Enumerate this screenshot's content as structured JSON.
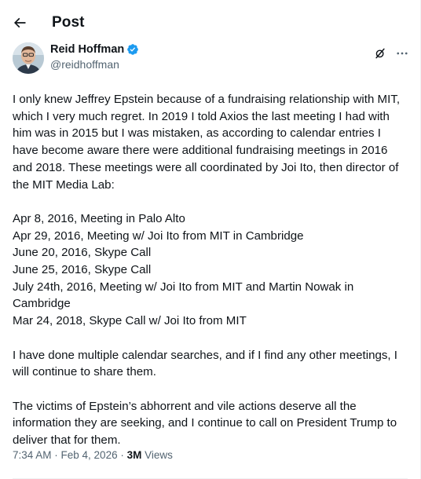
{
  "header": {
    "back_icon": "arrow-left-icon",
    "title": "Post"
  },
  "author": {
    "display_name": "Reid Hoffman",
    "handle": "@reidhoffman",
    "verified_color": "#1d9bf0",
    "verified_icon": "verified-badge-icon",
    "grok_icon": "grok-icon",
    "more_icon": "more-horizontal-icon"
  },
  "post": {
    "paragraphs": [
      "I only knew Jeffrey Epstein because of a fundraising relationship with MIT, which I very much regret. In 2019 I told Axios the last meeting I had with him was in 2015 but I was mistaken, as according to calendar entries I have become aware there were additional fundraising meetings in 2016 and 2018. These meetings were all coordinated by Joi Ito, then director of the MIT Media Lab:",
      "Apr 8, 2016, Meeting in Palo Alto\nApr 29, 2016, Meeting w/ Joi Ito from MIT in Cambridge\nJune 20, 2016, Skype Call\nJune 25, 2016, Skype Call\nJuly 24th, 2016, Meeting w/ Joi Ito from MIT and Martin Nowak in Cambridge\nMar 24, 2018, Skype Call w/ Joi Ito from MIT",
      "I have done multiple calendar searches, and if I find any other meetings, I will continue to share them.",
      "The victims of Epstein’s abhorrent and vile actions deserve all the information they are seeking, and I continue to call on President Trump to deliver that for them."
    ]
  },
  "meta": {
    "time": "7:34 AM",
    "separator": " · ",
    "date": "Feb 4, 2026",
    "views_count": "3M",
    "views_label": " Views"
  },
  "colors": {
    "text_primary": "#0f1419",
    "text_secondary": "#536471",
    "accent": "#1d9bf0"
  }
}
